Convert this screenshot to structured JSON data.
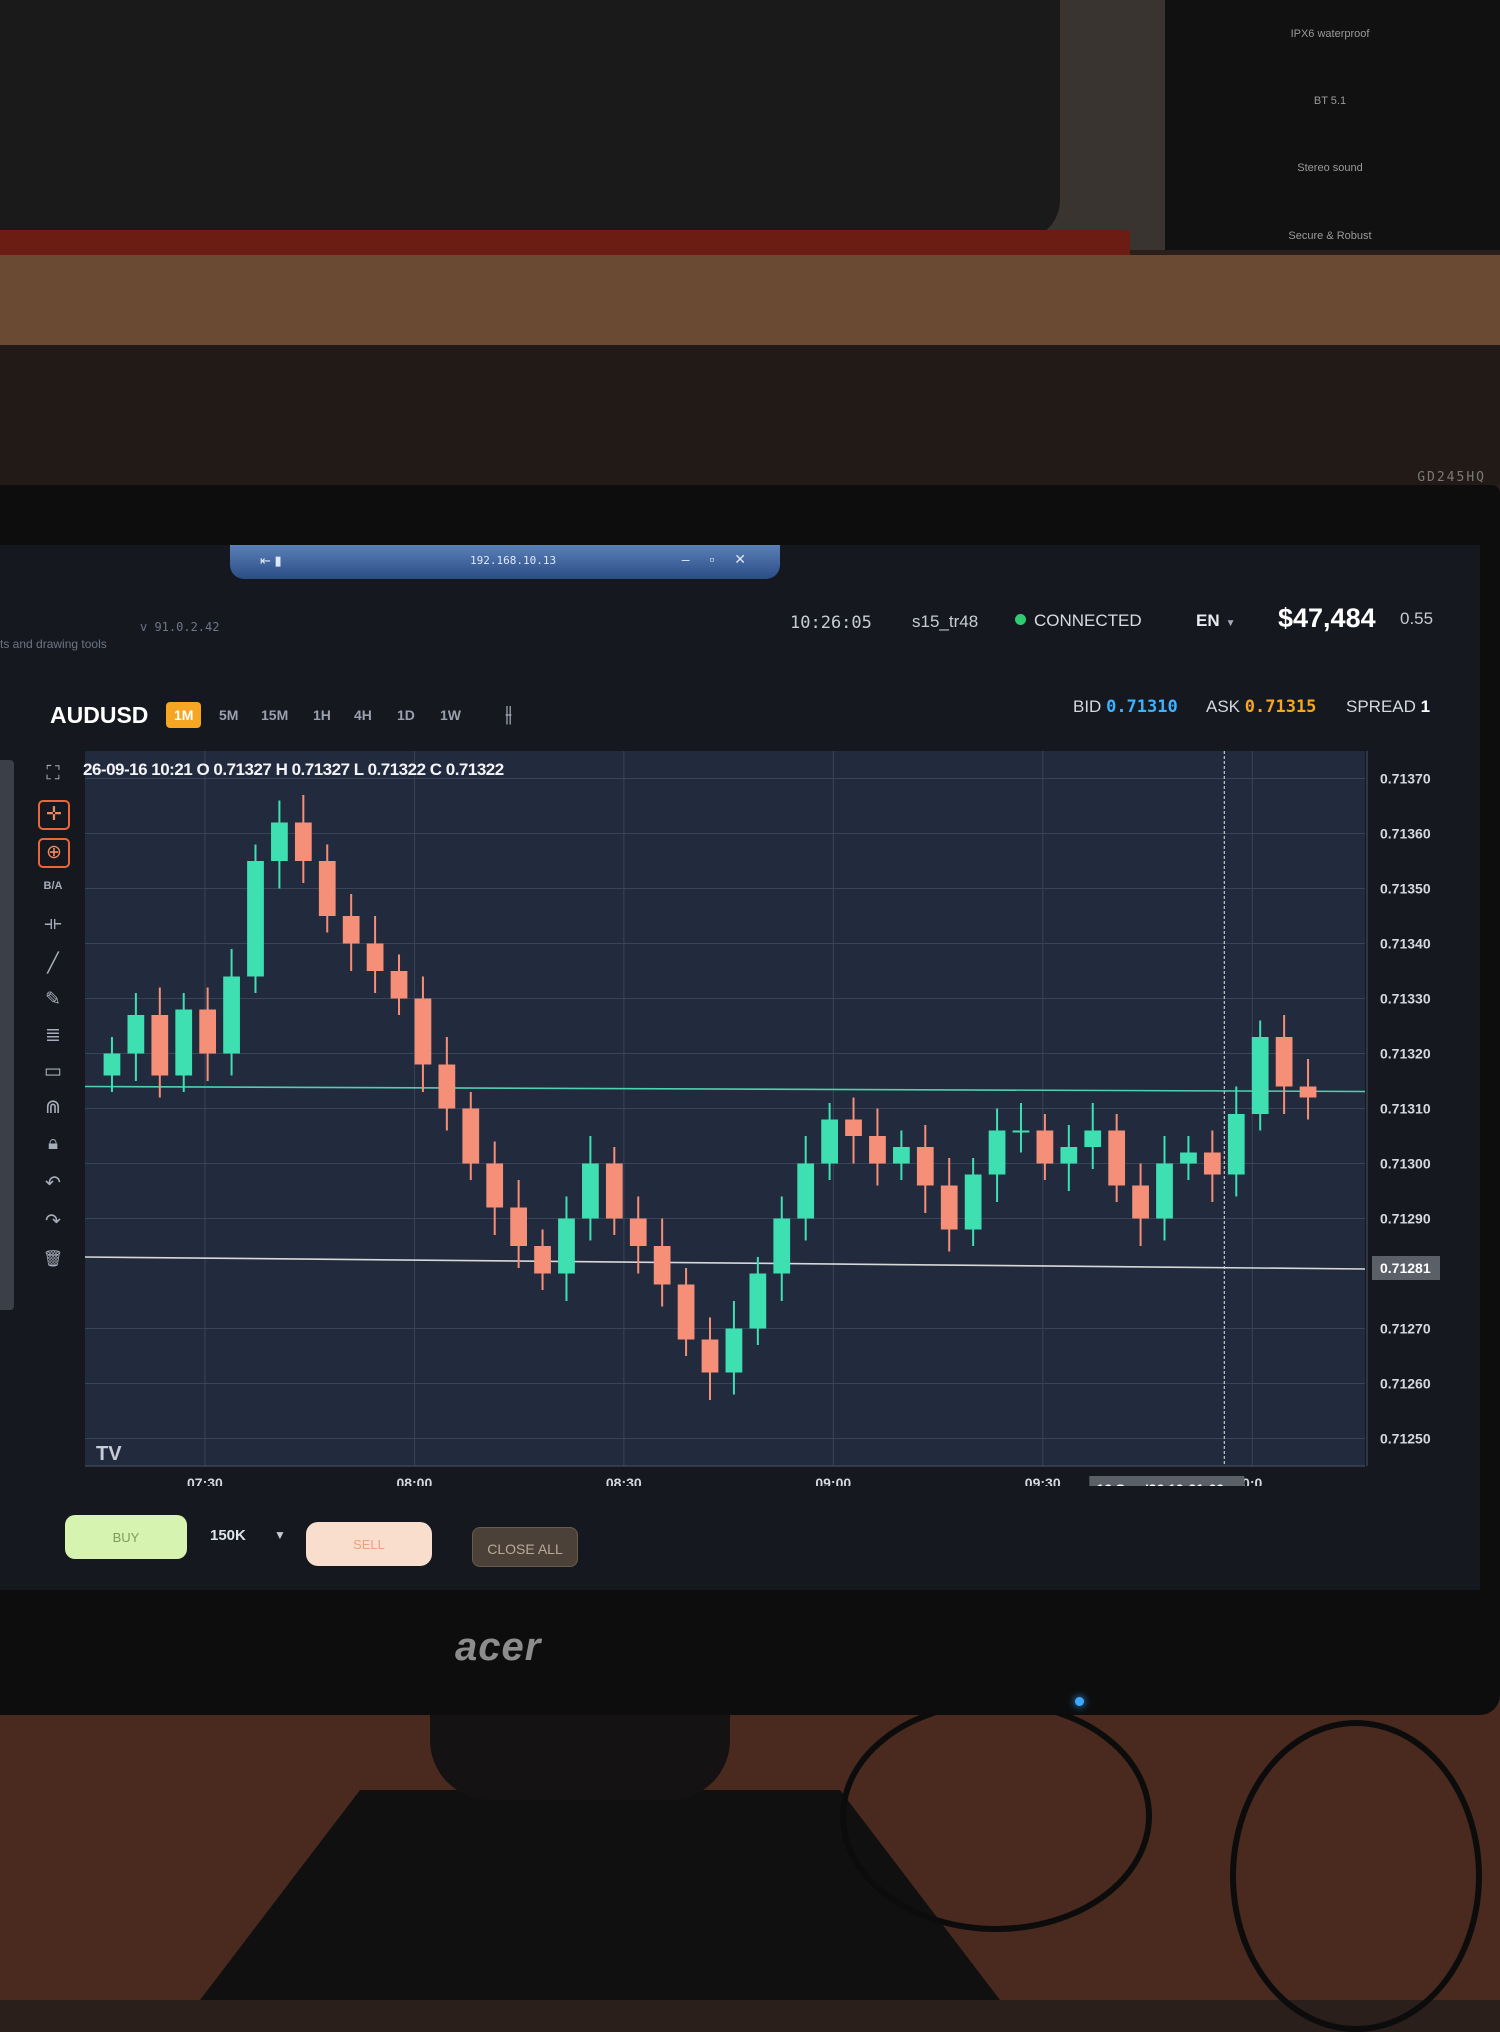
{
  "environment": {
    "speaker_box": {
      "features": [
        "IPX6 waterproof",
        "BT 5.1",
        "Stereo sound",
        "Secure & Robust"
      ]
    },
    "monitor": {
      "brand": "acer",
      "model": "GD245HQ"
    }
  },
  "remote_session": {
    "ip": "192.168.10.13",
    "controls": "– ▫ ✕"
  },
  "app": {
    "version": "v 91.0.2.42",
    "tools_hint": "ts and drawing tools"
  },
  "header": {
    "time": "10:26:05",
    "user": "s15_tr48",
    "status": "CONNECTED",
    "status_color": "#2ecc71",
    "language": "EN",
    "balance": "$47,484",
    "small_value": "0.55"
  },
  "symbol": "AUDUSD",
  "timeframes": [
    {
      "label": "1M",
      "active": true
    },
    {
      "label": "5M",
      "active": false
    },
    {
      "label": "15M",
      "active": false
    },
    {
      "label": "1H",
      "active": false
    },
    {
      "label": "4H",
      "active": false
    },
    {
      "label": "1D",
      "active": false
    },
    {
      "label": "1W",
      "active": false
    }
  ],
  "quotes": {
    "bid_label": "BID",
    "bid": "0.71310",
    "ask_label": "ASK",
    "ask": "0.71315",
    "spread_label": "SPREAD",
    "spread": "1"
  },
  "toolbar_icons": [
    "fullscreen-icon",
    "crosshair-icon",
    "add-icon",
    "bid-ask-icon",
    "measure-icon",
    "trendline-icon",
    "pencil-icon",
    "fib-icon",
    "rectangle-icon",
    "magnet-icon",
    "lock-icon",
    "undo-icon",
    "redo-icon",
    "trash-icon"
  ],
  "ohlc_legend": "26-09-16 10:21 O 0.71327 H 0.71327 L 0.71322 C 0.71322",
  "chart_data": {
    "type": "candlestick",
    "symbol": "AUDUSD",
    "timeframe": "1M",
    "ylim": [
      0.71245,
      0.71375
    ],
    "y_ticks": [
      "0.71370",
      "0.71360",
      "0.71350",
      "0.71340",
      "0.71330",
      "0.71320",
      "0.71310",
      "0.71300",
      "0.71290",
      "0.71281",
      "0.71270",
      "0.71260",
      "0.71250"
    ],
    "x_ticks": [
      "07:30",
      "08:00",
      "08:30",
      "09:00",
      "09:30",
      "10:0"
    ],
    "crosshair_label": "16 Sep '26   10:21:00",
    "crosshair_price": "0.71281",
    "horizontal_lines": [
      {
        "price": 0.71314,
        "color": "#4fd1b0"
      },
      {
        "price": 0.71283,
        "color": "#d8d8d8"
      }
    ],
    "up_color": "#3ee0b2",
    "down_color": "#f58f77",
    "closes": [
      0.7132,
      0.71327,
      0.71316,
      0.71328,
      0.7132,
      0.71334,
      0.71355,
      0.71362,
      0.71355,
      0.71345,
      0.7134,
      0.71335,
      0.7133,
      0.71318,
      0.7131,
      0.713,
      0.71292,
      0.71285,
      0.7128,
      0.7129,
      0.713,
      0.7129,
      0.71285,
      0.71278,
      0.71268,
      0.71262,
      0.7127,
      0.7128,
      0.7129,
      0.713,
      0.71308,
      0.71305,
      0.713,
      0.71303,
      0.71296,
      0.71288,
      0.71298,
      0.71306,
      0.71306,
      0.713,
      0.71303,
      0.71306,
      0.71296,
      0.7129,
      0.713,
      0.71302,
      0.71298,
      0.71309,
      0.71323,
      0.71314,
      0.71312
    ]
  },
  "order_bar": {
    "buy_label": "BUY",
    "quantity": "150K",
    "sell_label": "SELL",
    "close_all_label": "CLOSE ALL"
  },
  "watermark": "TV"
}
